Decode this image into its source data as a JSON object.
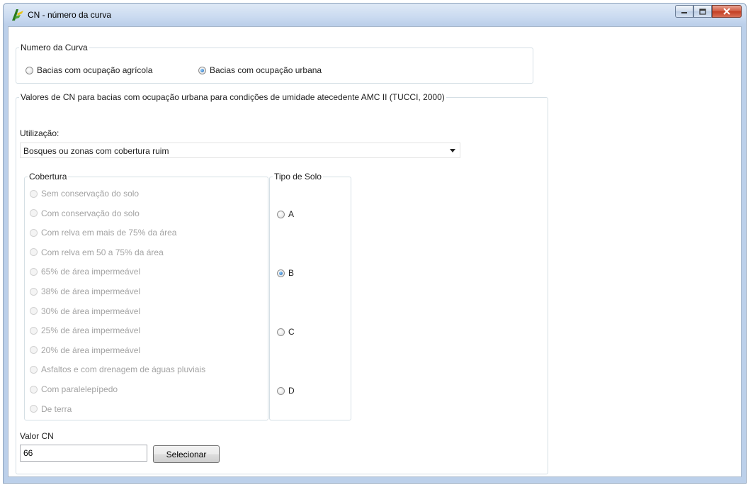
{
  "window": {
    "title": "CN - número da curva",
    "icon": "app-icon"
  },
  "curve_number": {
    "legend": "Numero da Curva",
    "options": [
      {
        "label": "Bacias com ocupação agrícola",
        "checked": false
      },
      {
        "label": "Bacias com ocupação urbana",
        "checked": true
      }
    ]
  },
  "urban_group": {
    "legend": "Valores de CN para bacias com ocupação urbana para condições de umidade atecedente AMC II (TUCCI,  2000)",
    "utilizacao_label": "Utilização:",
    "utilizacao_value": "Bosques ou zonas com cobertura ruim"
  },
  "cobertura": {
    "legend": "Cobertura",
    "enabled": false,
    "options": [
      "Sem conservação do solo",
      "Com conservação do solo",
      "Com relva em mais de 75% da área",
      "Com relva em 50 a 75% da área",
      "65% de área impermeável",
      "38% de área impermeável",
      "30% de área impermeável",
      "25% de área impermeável",
      "20% de área impermeável",
      "Asfaltos e com drenagem de águas pluviais",
      "Com paralelepípedo",
      "De terra"
    ]
  },
  "tipo_solo": {
    "legend": "Tipo de Solo",
    "options": [
      {
        "label": "A",
        "checked": false
      },
      {
        "label": "B",
        "checked": true
      },
      {
        "label": "C",
        "checked": false
      },
      {
        "label": "D",
        "checked": false
      }
    ]
  },
  "valor_cn": {
    "label": "Valor CN",
    "value": "66",
    "button_label": "Selecionar"
  }
}
